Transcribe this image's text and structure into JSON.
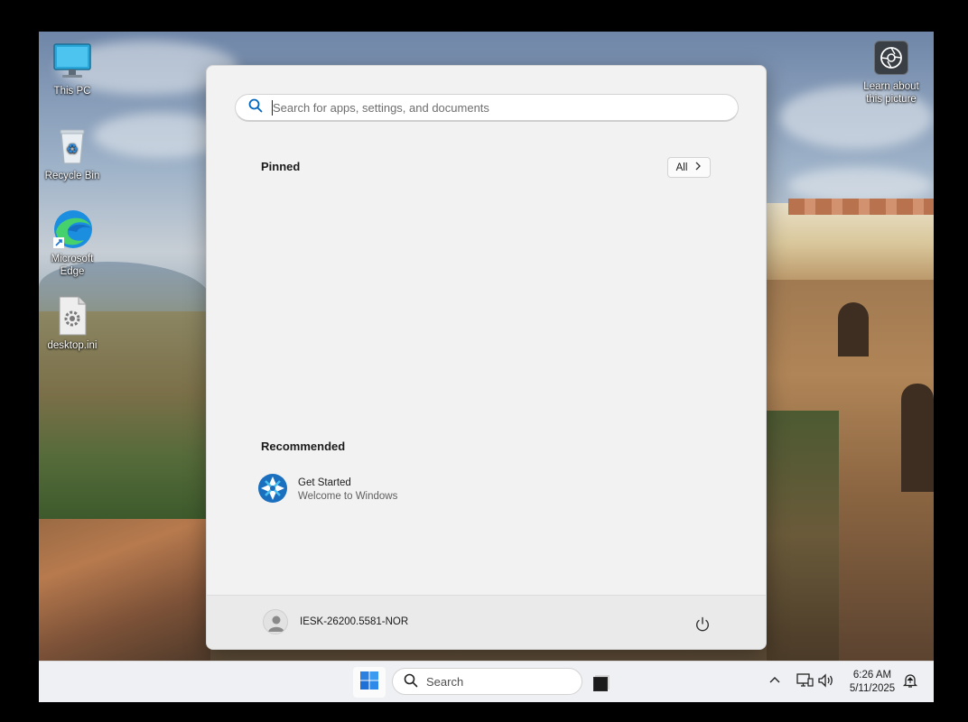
{
  "desktop": {
    "icons": [
      {
        "label": "This PC"
      },
      {
        "label": "Recycle Bin"
      },
      {
        "label": "Microsoft Edge"
      },
      {
        "label": "desktop.ini"
      }
    ],
    "learn_about_picture": "Learn about this picture"
  },
  "start_menu": {
    "search_placeholder": "Search for apps, settings, and documents",
    "pinned_title": "Pinned",
    "all_label": "All",
    "recommended_title": "Recommended",
    "recommended": [
      {
        "title": "Get Started",
        "subtitle": "Welcome to Windows"
      }
    ],
    "user_name": "IESK-26200.5581-NOR"
  },
  "taskbar": {
    "search_label": "Search",
    "time": "6:26 AM",
    "date": "5/11/2025"
  },
  "colors": {
    "accent": "#0078d4",
    "taskbar_bg": "#eef0f3",
    "start_bg": "#f2f2f2"
  }
}
